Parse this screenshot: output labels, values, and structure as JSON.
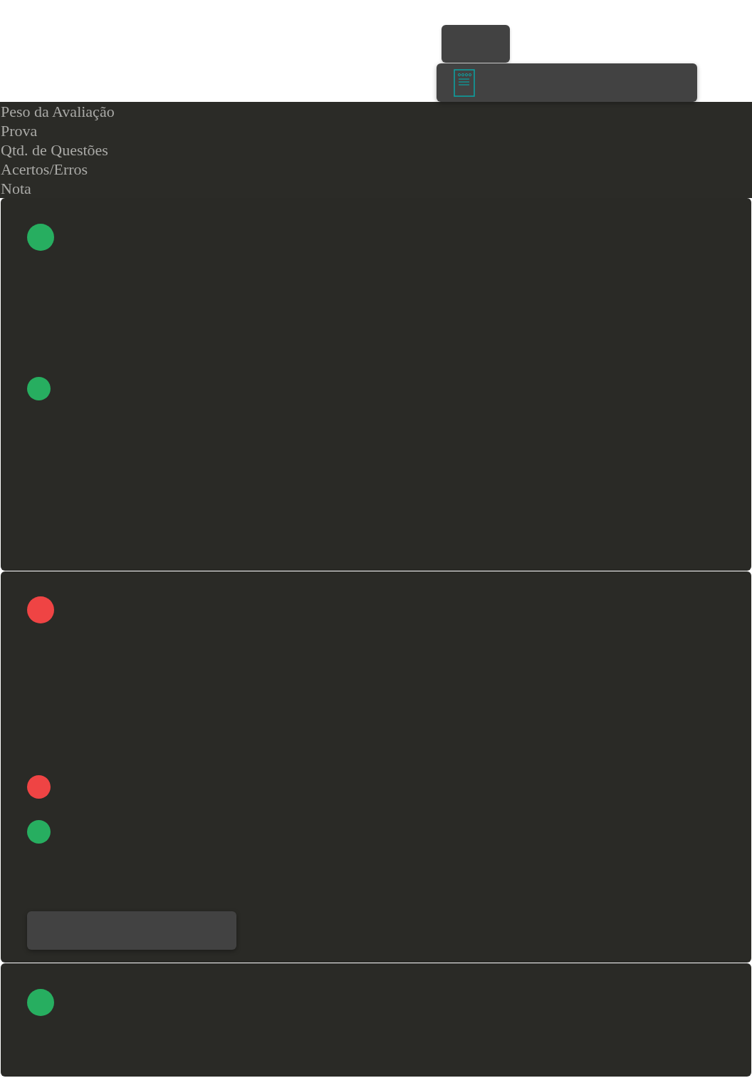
{
  "summary_labels": [
    "Peso da Avaliação",
    "Prova",
    "Qtd. de Questões",
    "Acertos/Erros",
    "Nota"
  ],
  "cards": [
    {
      "markers": [
        {
          "kind": "major",
          "color": "#27ae60"
        },
        {
          "kind": "minor",
          "color": "#27ae60"
        }
      ]
    },
    {
      "markers": [
        {
          "kind": "major",
          "color": "#ef4444"
        },
        {
          "kind": "minor",
          "color": "#ef4444"
        },
        {
          "kind": "minor",
          "color": "#27ae60"
        }
      ],
      "has_button": true
    },
    {
      "markers": [
        {
          "kind": "major",
          "color": "#27ae60"
        }
      ]
    }
  ]
}
